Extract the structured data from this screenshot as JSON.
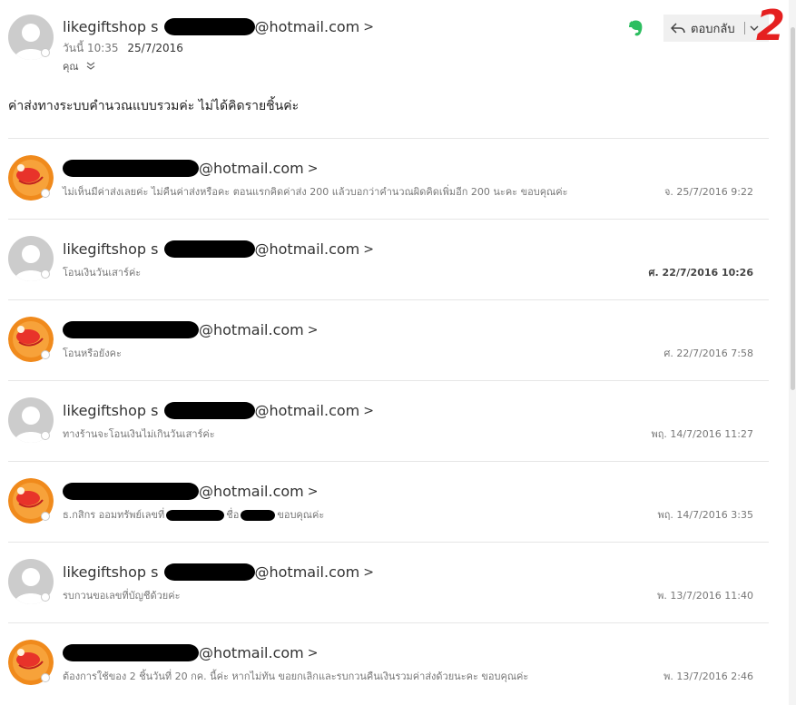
{
  "header": {
    "sender_name": "likegiftshop s",
    "sender_email_domain": "@hotmail.com",
    "chevron": ">",
    "date_prefix": "วันนี้ 10:35",
    "date": "25/7/2016",
    "to_label": "คุณ",
    "reply_label": "ตอบกลับ",
    "annotation": "2",
    "evernote_color": "#2dbe60",
    "annotation_color": "#e52020"
  },
  "body_text": "ค่าส่งทางระบบคำนวณแบบรวมค่ะ ไม่ได้คิดรายชิ้นค่ะ",
  "messages": [
    {
      "sender_prefix": "",
      "email_domain": "@hotmail.com",
      "chevron": ">",
      "snippet": "ไม่เห็นมีค่าส่งเลยค่ะ ไม่คืนค่าส่งหรือคะ ตอนแรกคิดค่าส่ง 200 แล้วบอกว่าคำนวณผิดคิดเพิ่มอีก 200 นะคะ ขอบคุณค่ะ",
      "date": "จ. 25/7/2016 9:22",
      "avatar": "orange"
    },
    {
      "sender_prefix": "likegiftshop s",
      "email_domain": "@hotmail.com",
      "chevron": ">",
      "snippet": "โอนเงินวันเสาร์ค่ะ",
      "date": "ศ. 22/7/2016 10:26",
      "avatar": "gray"
    },
    {
      "sender_prefix": "",
      "email_domain": "@hotmail.com",
      "chevron": ">",
      "snippet": "โอนหรือยังคะ",
      "date": "ศ. 22/7/2016 7:58",
      "avatar": "orange"
    },
    {
      "sender_prefix": "likegiftshop s",
      "email_domain": "@hotmail.com",
      "chevron": ">",
      "snippet": "ทางร้านจะโอนเงินไม่เกินวันเสาร์ค่ะ",
      "date": "พฤ. 14/7/2016 11:27",
      "avatar": "gray"
    },
    {
      "sender_prefix": "",
      "email_domain": "@hotmail.com",
      "chevron": ">",
      "snippet_a": "ธ.กสิกร ออมทรัพย์เลขที่",
      "snippet_b": "ชื่อ",
      "snippet_c": "ขอบคุณค่ะ",
      "date": "พฤ. 14/7/2016 3:35",
      "avatar": "orange"
    },
    {
      "sender_prefix": "likegiftshop s",
      "email_domain": "@hotmail.com",
      "chevron": ">",
      "snippet": "รบกวนขอเลขที่บัญชีด้วยค่ะ",
      "date": "พ. 13/7/2016 11:40",
      "avatar": "gray"
    },
    {
      "sender_prefix": "",
      "email_domain": "@hotmail.com",
      "chevron": ">",
      "snippet": "ต้องการใช้ของ 2 ชิ้นวันที่ 20 กค. นี้ค่ะ หากไม่ทัน ขอยกเลิกและรบกวนคืนเงินรวมค่าส่งด้วยนะคะ ขอบคุณค่ะ",
      "date": "พ. 13/7/2016 2:46",
      "avatar": "orange"
    }
  ]
}
